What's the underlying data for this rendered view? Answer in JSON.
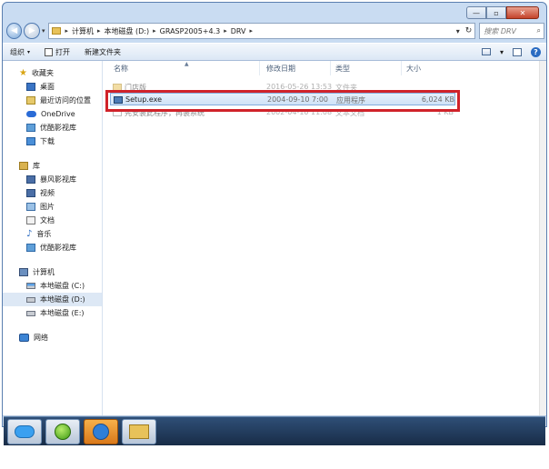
{
  "window": {
    "controls": {
      "minimize": "—",
      "maximize": "▫",
      "close": "✕"
    }
  },
  "address": {
    "back": "◀",
    "forward": "▶",
    "crumbs": [
      "计算机",
      "本地磁盘 (D:)",
      "GRASP2005+4.3",
      "DRV"
    ],
    "separator": "▸",
    "search_placeholder": "搜索 DRV"
  },
  "toolbar": {
    "organize_label": "组织",
    "open_label": "打开",
    "new_folder_label": "新建文件夹"
  },
  "sidebar": {
    "favorites_label": "收藏夹",
    "favorites": [
      "桌面",
      "最近访问的位置",
      "OneDrive",
      "优酷影视库",
      "下载"
    ],
    "libraries_label": "库",
    "libraries": [
      "暴风影视库",
      "视频",
      "图片",
      "文档",
      "音乐",
      "优酷影视库"
    ],
    "computer_label": "计算机",
    "drives": [
      "本地磁盘 (C:)",
      "本地磁盘 (D:)",
      "本地磁盘 (E:)"
    ],
    "network_label": "网络"
  },
  "columns": {
    "name": "名称",
    "date": "修改日期",
    "type": "类型",
    "size": "大小"
  },
  "files": [
    {
      "name": "门店版",
      "date": "2016-05-26 13:53",
      "type": "文件夹",
      "size": ""
    },
    {
      "name": "Setup.exe",
      "date": "2004-09-10 7:00",
      "type": "应用程序",
      "size": "6,024 KB"
    },
    {
      "name": "先安装此程序，再装系统",
      "date": "2002-04-10 11:08",
      "type": "文本文档",
      "size": "1 KB"
    }
  ],
  "highlight_color": "#d0222a",
  "icons": {
    "help": "?",
    "search": "⌕",
    "refresh": "↻",
    "dropdown": "▾"
  }
}
